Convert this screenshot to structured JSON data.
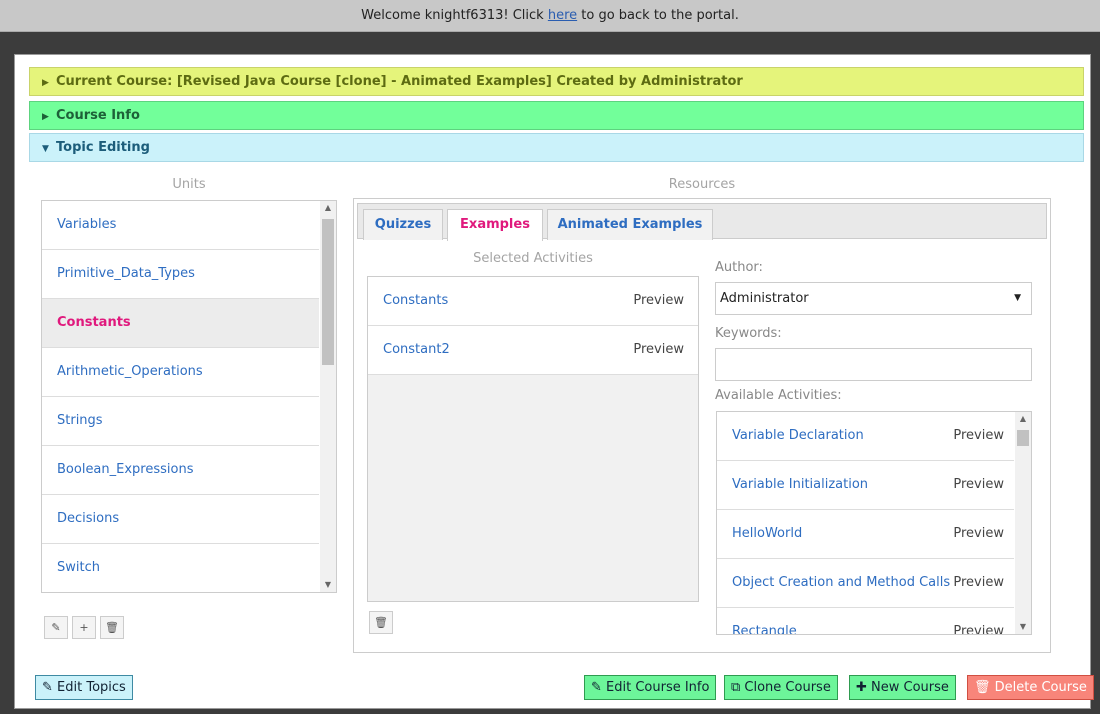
{
  "topbar": {
    "prefix": "Welcome knightf6313! Click ",
    "link": "here",
    "suffix": " to go back to the portal."
  },
  "accordion": {
    "current_course": "Current Course: [Revised Java Course [clone] - Animated Examples] Created by Administrator",
    "course_info": "Course Info",
    "topic_editing": "Topic Editing",
    "arrow_collapsed": "▶",
    "arrow_expanded": "▼"
  },
  "units": {
    "heading": "Units",
    "items": [
      "Variables",
      "Primitive_Data_Types",
      "Constants",
      "Arithmetic_Operations",
      "Strings",
      "Boolean_Expressions",
      "Decisions",
      "Switch"
    ],
    "active": "Constants",
    "buttons": {
      "edit": "✎",
      "add": "+",
      "delete": "🗑"
    }
  },
  "resources": {
    "heading": "Resources",
    "tabs": [
      "Quizzes",
      "Examples",
      "Animated Examples"
    ],
    "active_tab": "Examples",
    "selected_heading": "Selected Activities",
    "selected": [
      {
        "name": "Constants",
        "action": "Preview"
      },
      {
        "name": "Constant2",
        "action": "Preview"
      }
    ],
    "delete_icon": "🗑",
    "author_label": "Author:",
    "author_value": "Administrator",
    "keywords_label": "Keywords:",
    "keywords_value": "",
    "available_label": "Available Activities:",
    "available": [
      {
        "name": "Variable Declaration",
        "action": "Preview"
      },
      {
        "name": "Variable Initialization",
        "action": "Preview"
      },
      {
        "name": "HelloWorld",
        "action": "Preview"
      },
      {
        "name": "Object Creation and Method Calls",
        "action": "Preview"
      },
      {
        "name": "Rectangle",
        "action": "Preview"
      }
    ]
  },
  "footer": {
    "edit_topics": "✎ Edit Topics",
    "edit_course_info": "✎ Edit Course Info",
    "clone_course": "⧉ Clone Course",
    "new_course": "✚ New Course",
    "delete_course": "🗑 Delete Course"
  },
  "colors": {
    "current_course_bg": "#e5f47b",
    "course_info_bg": "#72ff9a",
    "topic_editing_bg": "#cbf2fa",
    "link": "#2e6dc1",
    "active": "#e0197d",
    "delete": "#f8857a"
  }
}
